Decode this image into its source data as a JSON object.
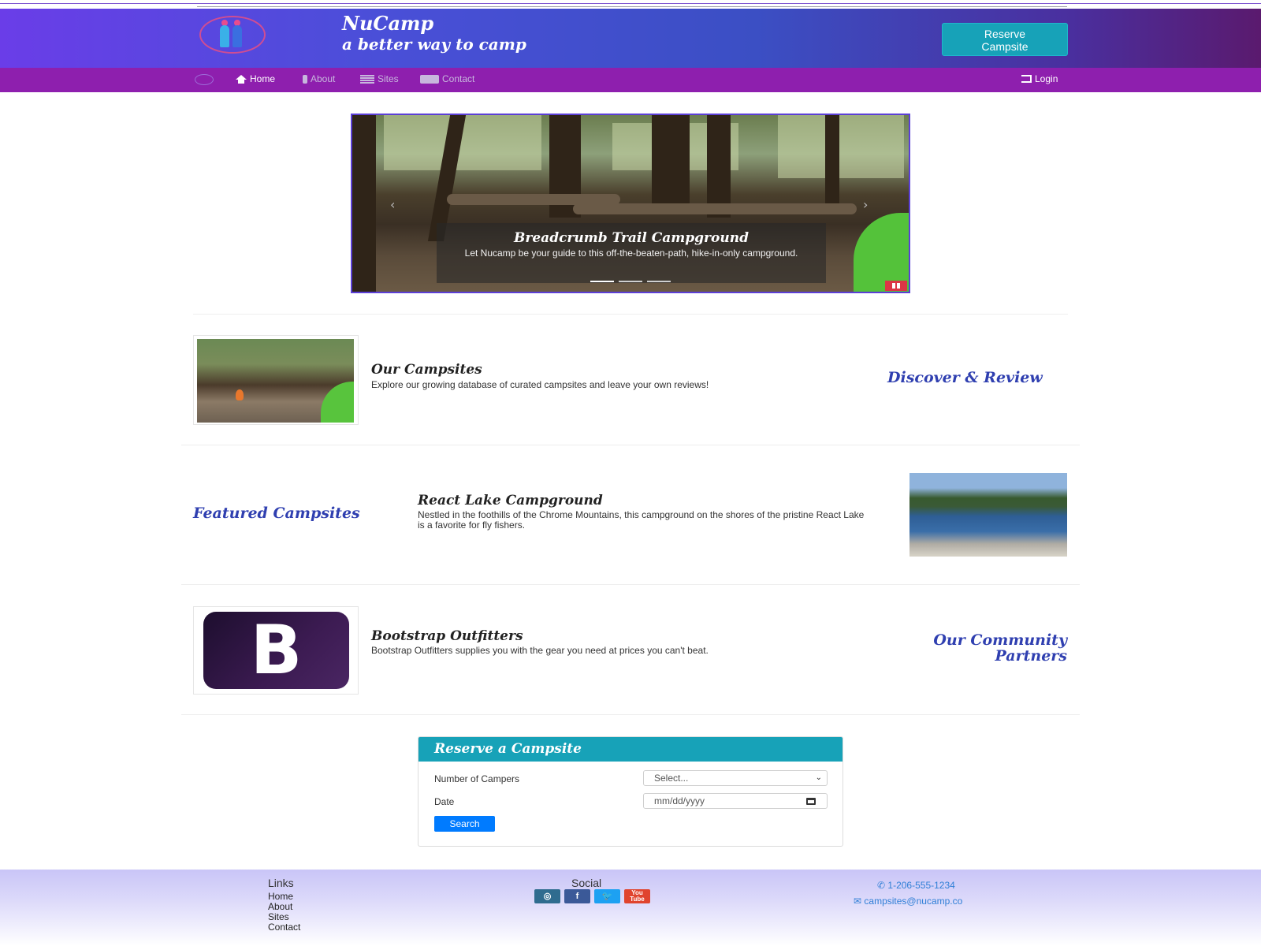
{
  "brand": {
    "title": "NuCamp",
    "subtitle": "a better way to camp"
  },
  "header": {
    "reserve_label_1": "Reserve",
    "reserve_label_2": "Campsite"
  },
  "nav": {
    "items": [
      {
        "label": "Home",
        "icon": "home-icon",
        "active": true
      },
      {
        "label": "About",
        "icon": "info-icon",
        "active": false
      },
      {
        "label": "Sites",
        "icon": "list-icon",
        "active": false
      },
      {
        "label": "Contact",
        "icon": "address-card-icon",
        "active": false
      }
    ],
    "login_label": "Login"
  },
  "carousel": {
    "caption_title": "Breadcrumb Trail Campground",
    "caption_text": "Let Nucamp be your guide to this off-the-beaten-path, hike-in-only campground.",
    "indicators": 3,
    "active_indicator": 0
  },
  "media": [
    {
      "title": "Our Campsites",
      "text": "Explore our growing database of curated campsites and leave your own reviews!",
      "side_heading": "Discover & Review"
    },
    {
      "title": "React Lake Campground",
      "text": "Nestled in the foothills of the Chrome Mountains, this campground on the shores of the pristine React Lake is a favorite for fly fishers.",
      "side_heading": "Featured Campsites"
    },
    {
      "title": "Bootstrap Outfitters",
      "text": "Bootstrap Outfitters supplies you with the gear you need at prices you can't beat.",
      "side_heading_1": "Our Community",
      "side_heading_2": "Partners",
      "logo_letter": "B"
    }
  ],
  "reserve_form": {
    "heading": "Reserve a Campsite",
    "campers_label": "Number of Campers",
    "campers_value": "Select...",
    "date_label": "Date",
    "date_placeholder": "mm/dd/yyyy",
    "search_label": "Search"
  },
  "footer": {
    "links_heading": "Links",
    "links": [
      "Home",
      "About",
      "Sites",
      "Contact"
    ],
    "social_heading": "Social",
    "social": [
      {
        "name": "instagram-icon",
        "color": "#2f6c8f"
      },
      {
        "name": "facebook-icon",
        "color": "#3b5998"
      },
      {
        "name": "twitter-icon",
        "color": "#1da1f2",
        "symbol": "🐦"
      },
      {
        "name": "youtube-icon",
        "color": "#e0442e",
        "symbol": "You Tube"
      }
    ],
    "phone": "1-206-555-1234",
    "email": "campsites@nucamp.co"
  },
  "colors": {
    "accent": "#17a2b8",
    "navbar": "#8e1fae",
    "heading_blue": "#2f3fb0",
    "primary_button": "#007bff"
  }
}
